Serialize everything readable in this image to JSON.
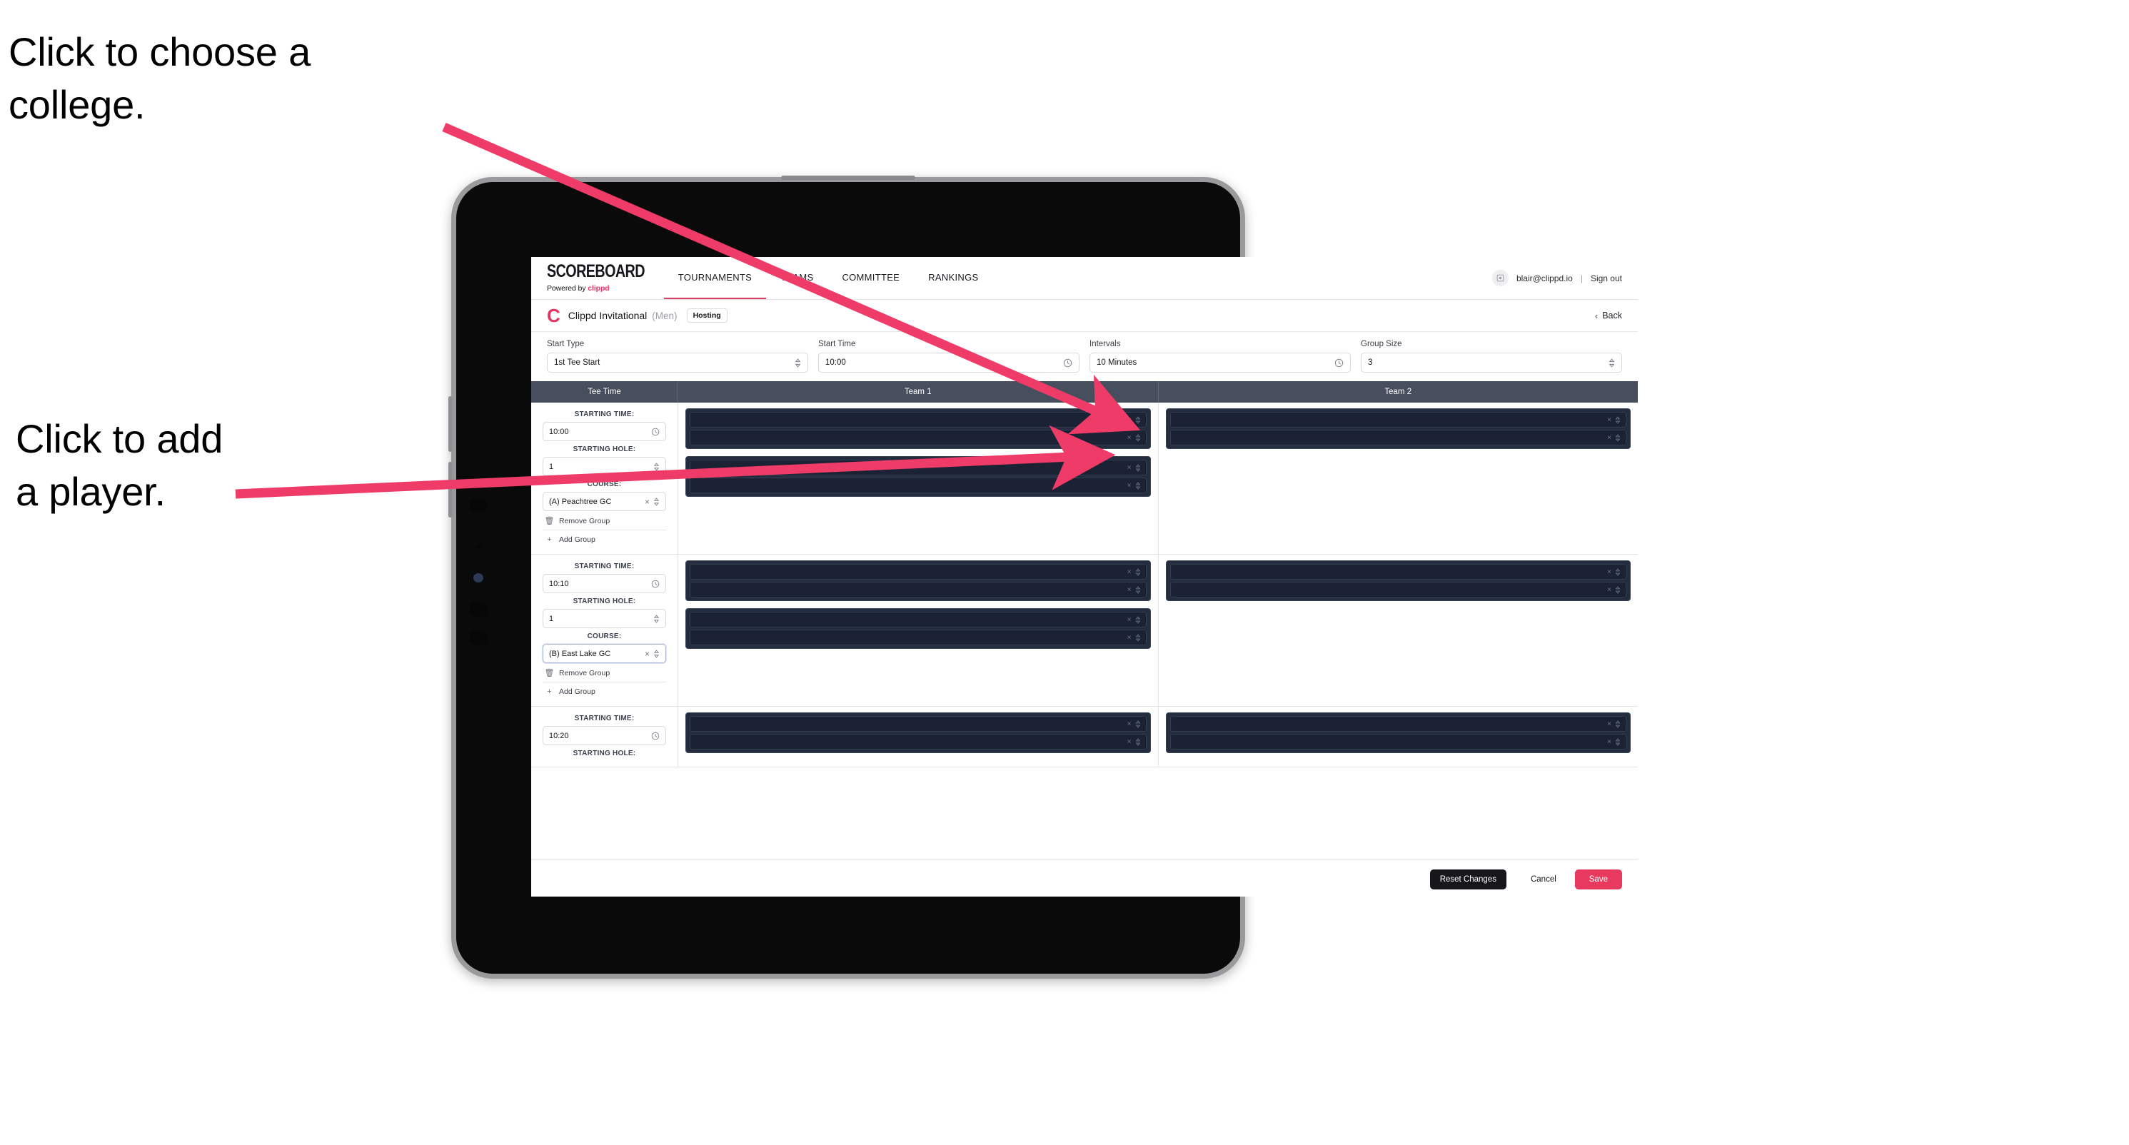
{
  "annotations": {
    "college": "Click to choose a\ncollege.",
    "player": "Click to add\na player."
  },
  "colors": {
    "accent_pink": "#e8395f",
    "arrow_pink": "#ef3b68",
    "header_slate": "#474f5e",
    "dark_group": "#242d3d",
    "dark_row": "#1a2233"
  },
  "topnav": {
    "brand_word": "SCOREBOARD",
    "brand_sub_prefix": "Powered by ",
    "brand_sub_name": "clippd",
    "links": [
      {
        "label": "TOURNAMENTS",
        "active": true
      },
      {
        "label": "TEAMS",
        "active": false
      },
      {
        "label": "COMMITTEE",
        "active": false
      },
      {
        "label": "RANKINGS",
        "active": false
      }
    ],
    "avatar_icon": "user-avatar-icon",
    "email": "blair@clippd.io",
    "separator": "|",
    "sign_out": "Sign out"
  },
  "tournament_bar": {
    "logo_letter": "C",
    "title": "Clippd Invitational",
    "gender": "(Men)",
    "badge": "Hosting",
    "back_chevron": "‹",
    "back_label": "Back"
  },
  "controls": [
    {
      "label": "Start Type",
      "value": "1st Tee Start",
      "icon": "stepper-icon"
    },
    {
      "label": "Start Time",
      "value": "10:00",
      "icon": "clock-icon"
    },
    {
      "label": "Intervals",
      "value": "10 Minutes",
      "icon": "clock-icon"
    },
    {
      "label": "Group Size",
      "value": "3",
      "icon": "stepper-icon"
    }
  ],
  "table": {
    "columns": [
      "Tee Time",
      "Team 1",
      "Team 2"
    ],
    "tee_labels": {
      "starting_time": "STARTING TIME:",
      "starting_hole": "STARTING HOLE:",
      "course": "COURSE:"
    },
    "group_actions": {
      "remove": "Remove Group",
      "add": "Add Group",
      "remove_icon": "trash-icon",
      "add_icon": "plus-icon"
    },
    "rows": [
      {
        "starting_time": "10:00",
        "starting_hole": "1",
        "course": "(A) Peachtree GC",
        "course_focused": false,
        "team1_groups": [
          {
            "players": [
              "",
              ""
            ]
          },
          {
            "players": [
              "",
              ""
            ]
          }
        ],
        "team2_groups": [
          {
            "players": [
              "",
              ""
            ]
          }
        ]
      },
      {
        "starting_time": "10:10",
        "starting_hole": "1",
        "course": "(B) East Lake GC",
        "course_focused": true,
        "team1_groups": [
          {
            "players": [
              "",
              ""
            ]
          },
          {
            "players": [
              "",
              ""
            ]
          }
        ],
        "team2_groups": [
          {
            "players": [
              "",
              ""
            ]
          }
        ]
      },
      {
        "starting_time": "10:20",
        "starting_hole": "",
        "course": "",
        "course_focused": false,
        "team1_groups": [
          {
            "players": [
              "",
              ""
            ]
          }
        ],
        "team2_groups": [
          {
            "players": [
              "",
              ""
            ]
          }
        ]
      }
    ]
  },
  "footer": {
    "reset": "Reset Changes",
    "cancel": "Cancel",
    "save": "Save"
  }
}
